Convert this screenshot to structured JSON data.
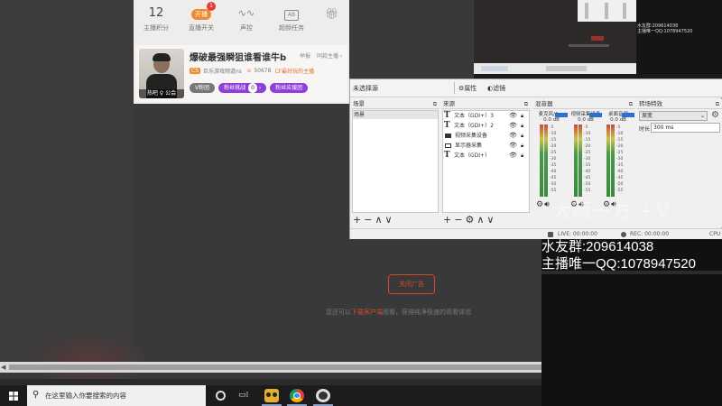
{
  "web": {
    "nav": [
      {
        "value": "12",
        "label": "主播积分"
      },
      {
        "icon": "开播",
        "label": "直播开关",
        "badge": "1"
      },
      {
        "icon": "wave-icon",
        "label": "声控"
      },
      {
        "icon": "AB",
        "label": "超频任务"
      },
      {
        "icon": "gift-icon",
        "label": ""
      }
    ],
    "streamer": {
      "title": "爆破最强瞬狙谁看谁牛b",
      "report": "举报",
      "similar": "同款主播 ›",
      "level": "CS",
      "channel": "巨乐游戏频道ns",
      "heat": "50678",
      "tag": "CF最好玩的主播",
      "avatar_tag": "热吧 ♀ 公会",
      "btn_vip": "V粉团",
      "btn_fans": "粉丝挑战",
      "btn_fans_num": "0",
      "btn_support": "粉丝应援团"
    },
    "close_ad": "关闭广告",
    "tip_before": "您还可以",
    "tip_link": "下载客户端",
    "tip_after": "观看，获得纯净极速的观看体验"
  },
  "preview": {
    "cam_line1": "水友群:209614038",
    "cam_line2": "主播唯一QQ:1078947520"
  },
  "obs": {
    "scene_name": "未选择源",
    "properties": "属性",
    "filters": "滤镜",
    "scenes_title": "场景",
    "scenes": [
      "场景"
    ],
    "sources_title": "来源",
    "sources": [
      {
        "type": "text",
        "label": "文本（GDI+）3"
      },
      {
        "type": "text",
        "label": "文本（GDI+）2"
      },
      {
        "type": "video",
        "label": "视频采集设备"
      },
      {
        "type": "display",
        "label": "显示器采集"
      },
      {
        "type": "text",
        "label": "文本（GDI+）"
      }
    ],
    "mixer_title": "混音器",
    "mixer": [
      {
        "name": "麦克风/Aux",
        "db": "0.0 dB"
      },
      {
        "name": "视频采集设备",
        "db": "0.0 dB"
      },
      {
        "name": "桌面音频",
        "db": "0.0 dB"
      }
    ],
    "mixer_scale": [
      "-5",
      "-10",
      "-15",
      "-20",
      "-25",
      "-30",
      "-35",
      "-40",
      "-45",
      "-50",
      "-55"
    ],
    "transitions_title": "转场特效",
    "transition": "渐变",
    "duration_label": "时长",
    "duration": "300 ms",
    "status_live": "LIVE: 00:00:00",
    "status_rec": "REC: 00:00:00",
    "status_cpu": "CPU"
  },
  "overlay": {
    "signature": "大雨一方  +V",
    "line1": "水友群:209614038",
    "line2": "主播唯一QQ:1078947520"
  },
  "taskbar": {
    "search_placeholder": "在这里输入你要搜索的内容"
  },
  "colors": {
    "accent_orange": "#f08a2d",
    "accent_purple": "#8e3ed9",
    "ad_red": "#d24a2a",
    "fader_blue": "#2a6fd1"
  }
}
